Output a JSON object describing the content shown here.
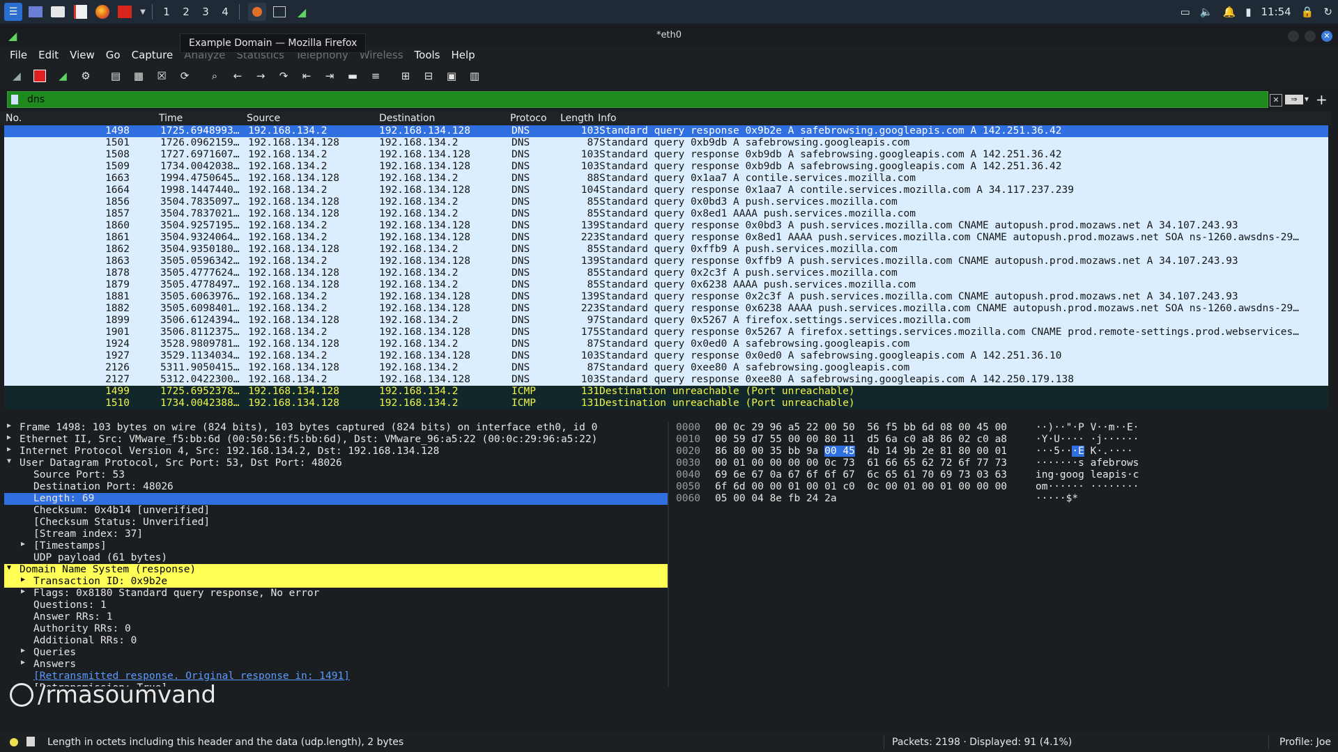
{
  "taskbar": {
    "workspaces": [
      "1",
      "2",
      "3",
      "4"
    ],
    "clock": "11:54"
  },
  "tooltip": "Example Domain — Mozilla Firefox",
  "window": {
    "title": "*eth0"
  },
  "menu": [
    "File",
    "Edit",
    "View",
    "Go",
    "Capture",
    "Analyze",
    "Statistics",
    "Telephony",
    "Wireless",
    "Tools",
    "Help"
  ],
  "filter": {
    "value": "dns"
  },
  "columns": [
    "No.",
    "Time",
    "Source",
    "Destination",
    "Protoco",
    "Length",
    "Info"
  ],
  "packets": [
    {
      "no": "1498",
      "time": "1725.6948993…",
      "src": "192.168.134.2",
      "dst": "192.168.134.128",
      "proto": "DNS",
      "len": "103",
      "info": "Standard query response 0x9b2e A safebrowsing.googleapis.com A 142.251.36.42",
      "type": "sel"
    },
    {
      "no": "1501",
      "time": "1726.0962159…",
      "src": "192.168.134.128",
      "dst": "192.168.134.2",
      "proto": "DNS",
      "len": "87",
      "info": "Standard query 0xb9db A safebrowsing.googleapis.com",
      "type": "dns"
    },
    {
      "no": "1508",
      "time": "1727.6971607…",
      "src": "192.168.134.2",
      "dst": "192.168.134.128",
      "proto": "DNS",
      "len": "103",
      "info": "Standard query response 0xb9db A safebrowsing.googleapis.com A 142.251.36.42",
      "type": "dns"
    },
    {
      "no": "1509",
      "time": "1734.0042038…",
      "src": "192.168.134.2",
      "dst": "192.168.134.128",
      "proto": "DNS",
      "len": "103",
      "info": "Standard query response 0xb9db A safebrowsing.googleapis.com A 142.251.36.42",
      "type": "dns"
    },
    {
      "no": "1663",
      "time": "1994.4750645…",
      "src": "192.168.134.128",
      "dst": "192.168.134.2",
      "proto": "DNS",
      "len": "88",
      "info": "Standard query 0x1aa7 A contile.services.mozilla.com",
      "type": "dns"
    },
    {
      "no": "1664",
      "time": "1998.1447440…",
      "src": "192.168.134.2",
      "dst": "192.168.134.128",
      "proto": "DNS",
      "len": "104",
      "info": "Standard query response 0x1aa7 A contile.services.mozilla.com A 34.117.237.239",
      "type": "dns"
    },
    {
      "no": "1856",
      "time": "3504.7835097…",
      "src": "192.168.134.128",
      "dst": "192.168.134.2",
      "proto": "DNS",
      "len": "85",
      "info": "Standard query 0x0bd3 A push.services.mozilla.com",
      "type": "dns"
    },
    {
      "no": "1857",
      "time": "3504.7837021…",
      "src": "192.168.134.128",
      "dst": "192.168.134.2",
      "proto": "DNS",
      "len": "85",
      "info": "Standard query 0x8ed1 AAAA push.services.mozilla.com",
      "type": "dns"
    },
    {
      "no": "1860",
      "time": "3504.9257195…",
      "src": "192.168.134.2",
      "dst": "192.168.134.128",
      "proto": "DNS",
      "len": "139",
      "info": "Standard query response 0x0bd3 A push.services.mozilla.com CNAME autopush.prod.mozaws.net A 34.107.243.93",
      "type": "dns"
    },
    {
      "no": "1861",
      "time": "3504.9324064…",
      "src": "192.168.134.2",
      "dst": "192.168.134.128",
      "proto": "DNS",
      "len": "223",
      "info": "Standard query response 0x8ed1 AAAA push.services.mozilla.com CNAME autopush.prod.mozaws.net SOA ns-1260.awsdns-29…",
      "type": "dns"
    },
    {
      "no": "1862",
      "time": "3504.9350180…",
      "src": "192.168.134.128",
      "dst": "192.168.134.2",
      "proto": "DNS",
      "len": "85",
      "info": "Standard query 0xffb9 A push.services.mozilla.com",
      "type": "dns"
    },
    {
      "no": "1863",
      "time": "3505.0596342…",
      "src": "192.168.134.2",
      "dst": "192.168.134.128",
      "proto": "DNS",
      "len": "139",
      "info": "Standard query response 0xffb9 A push.services.mozilla.com CNAME autopush.prod.mozaws.net A 34.107.243.93",
      "type": "dns"
    },
    {
      "no": "1878",
      "time": "3505.4777624…",
      "src": "192.168.134.128",
      "dst": "192.168.134.2",
      "proto": "DNS",
      "len": "85",
      "info": "Standard query 0x2c3f A push.services.mozilla.com",
      "type": "dns"
    },
    {
      "no": "1879",
      "time": "3505.4778497…",
      "src": "192.168.134.128",
      "dst": "192.168.134.2",
      "proto": "DNS",
      "len": "85",
      "info": "Standard query 0x6238 AAAA push.services.mozilla.com",
      "type": "dns"
    },
    {
      "no": "1881",
      "time": "3505.6063976…",
      "src": "192.168.134.2",
      "dst": "192.168.134.128",
      "proto": "DNS",
      "len": "139",
      "info": "Standard query response 0x2c3f A push.services.mozilla.com CNAME autopush.prod.mozaws.net A 34.107.243.93",
      "type": "dns"
    },
    {
      "no": "1882",
      "time": "3505.6098401…",
      "src": "192.168.134.2",
      "dst": "192.168.134.128",
      "proto": "DNS",
      "len": "223",
      "info": "Standard query response 0x6238 AAAA push.services.mozilla.com CNAME autopush.prod.mozaws.net SOA ns-1260.awsdns-29…",
      "type": "dns"
    },
    {
      "no": "1899",
      "time": "3506.6124394…",
      "src": "192.168.134.128",
      "dst": "192.168.134.2",
      "proto": "DNS",
      "len": "97",
      "info": "Standard query 0x5267 A firefox.settings.services.mozilla.com",
      "type": "dns"
    },
    {
      "no": "1901",
      "time": "3506.8112375…",
      "src": "192.168.134.2",
      "dst": "192.168.134.128",
      "proto": "DNS",
      "len": "175",
      "info": "Standard query response 0x5267 A firefox.settings.services.mozilla.com CNAME prod.remote-settings.prod.webservices…",
      "type": "dns"
    },
    {
      "no": "1924",
      "time": "3528.9809781…",
      "src": "192.168.134.128",
      "dst": "192.168.134.2",
      "proto": "DNS",
      "len": "87",
      "info": "Standard query 0x0ed0 A safebrowsing.googleapis.com",
      "type": "dns"
    },
    {
      "no": "1927",
      "time": "3529.1134034…",
      "src": "192.168.134.2",
      "dst": "192.168.134.128",
      "proto": "DNS",
      "len": "103",
      "info": "Standard query response 0x0ed0 A safebrowsing.googleapis.com A 142.251.36.10",
      "type": "dns"
    },
    {
      "no": "2126",
      "time": "5311.9050415…",
      "src": "192.168.134.128",
      "dst": "192.168.134.2",
      "proto": "DNS",
      "len": "87",
      "info": "Standard query 0xee80 A safebrowsing.googleapis.com",
      "type": "dns"
    },
    {
      "no": "2127",
      "time": "5312.0422300…",
      "src": "192.168.134.2",
      "dst": "192.168.134.128",
      "proto": "DNS",
      "len": "103",
      "info": "Standard query response 0xee80 A safebrowsing.googleapis.com A 142.250.179.138",
      "type": "dns"
    },
    {
      "no": "1499",
      "time": "1725.6952378…",
      "src": "192.168.134.128",
      "dst": "192.168.134.2",
      "proto": "ICMP",
      "len": "131",
      "info": "Destination unreachable (Port unreachable)",
      "type": "icmp"
    },
    {
      "no": "1510",
      "time": "1734.0042388…",
      "src": "192.168.134.128",
      "dst": "192.168.134.2",
      "proto": "ICMP",
      "len": "131",
      "info": "Destination unreachable (Port unreachable)",
      "type": "icmp"
    }
  ],
  "details": [
    {
      "indent": 0,
      "arrow": "right",
      "text": "Frame 1498: 103 bytes on wire (824 bits), 103 bytes captured (824 bits) on interface eth0, id 0"
    },
    {
      "indent": 0,
      "arrow": "right",
      "text": "Ethernet II, Src: VMware_f5:bb:6d (00:50:56:f5:bb:6d), Dst: VMware_96:a5:22 (00:0c:29:96:a5:22)"
    },
    {
      "indent": 0,
      "arrow": "right",
      "text": "Internet Protocol Version 4, Src: 192.168.134.2, Dst: 192.168.134.128"
    },
    {
      "indent": 0,
      "arrow": "down",
      "text": "User Datagram Protocol, Src Port: 53, Dst Port: 48026"
    },
    {
      "indent": 1,
      "arrow": "",
      "text": "Source Port: 53"
    },
    {
      "indent": 1,
      "arrow": "",
      "text": "Destination Port: 48026"
    },
    {
      "indent": 1,
      "arrow": "",
      "text": "Length: 69",
      "style": "sel"
    },
    {
      "indent": 1,
      "arrow": "",
      "text": "Checksum: 0x4b14 [unverified]"
    },
    {
      "indent": 1,
      "arrow": "",
      "text": "[Checksum Status: Unverified]"
    },
    {
      "indent": 1,
      "arrow": "",
      "text": "[Stream index: 37]"
    },
    {
      "indent": 1,
      "arrow": "right",
      "text": "[Timestamps]"
    },
    {
      "indent": 1,
      "arrow": "",
      "text": "UDP payload (61 bytes)"
    },
    {
      "indent": 0,
      "arrow": "down",
      "text": "Domain Name System (response)",
      "style": "yellow"
    },
    {
      "indent": 1,
      "arrow": "right",
      "text": "Transaction ID: 0x9b2e",
      "style": "yellow"
    },
    {
      "indent": 1,
      "arrow": "right",
      "text": "Flags: 0x8180 Standard query response, No error"
    },
    {
      "indent": 1,
      "arrow": "",
      "text": "Questions: 1"
    },
    {
      "indent": 1,
      "arrow": "",
      "text": "Answer RRs: 1"
    },
    {
      "indent": 1,
      "arrow": "",
      "text": "Authority RRs: 0"
    },
    {
      "indent": 1,
      "arrow": "",
      "text": "Additional RRs: 0"
    },
    {
      "indent": 1,
      "arrow": "right",
      "text": "Queries"
    },
    {
      "indent": 1,
      "arrow": "right",
      "text": "Answers"
    },
    {
      "indent": 1,
      "arrow": "",
      "text": "[Retransmitted response. Original response in: 1491]",
      "style": "link"
    },
    {
      "indent": 1,
      "arrow": "",
      "text": "[Retransmission: True]"
    }
  ],
  "bytes": [
    {
      "off": "0000",
      "hex": "00 0c 29 96 a5 22 00 50  56 f5 bb 6d 08 00 45 00",
      "asc": "··)··\"·P V··m··E·"
    },
    {
      "off": "0010",
      "hex": "00 59 d7 55 00 00 80 11  d5 6a c0 a8 86 02 c0 a8",
      "asc": "·Y·U···· ·j······"
    },
    {
      "off": "0020",
      "hex_pre": "86 80 00 35 bb 9a ",
      "hex_hl": "00 45",
      "hex_post": "  4b 14 9b 2e 81 80 00 01",
      "asc_pre": "···5··",
      "asc_hl": "·E",
      "asc_post": " K·.····"
    },
    {
      "off": "0030",
      "hex": "00 01 00 00 00 00 0c 73  61 66 65 62 72 6f 77 73",
      "asc": "·······s afebrows"
    },
    {
      "off": "0040",
      "hex": "69 6e 67 0a 67 6f 6f 67  6c 65 61 70 69 73 03 63",
      "asc": "ing·goog leapis·c"
    },
    {
      "off": "0050",
      "hex": "6f 6d 00 00 01 00 01 c0  0c 00 01 00 01 00 00 00",
      "asc": "om······ ········"
    },
    {
      "off": "0060",
      "hex": "05 00 04 8e fb 24 2a",
      "asc": "·····$*"
    }
  ],
  "watermark": "/rmasoumvand",
  "status": {
    "text": "Length in octets including this header and the data (udp.length), 2 bytes",
    "packets": "Packets: 2198 · Displayed: 91 (4.1%)",
    "profile": "Profile: Joe"
  }
}
